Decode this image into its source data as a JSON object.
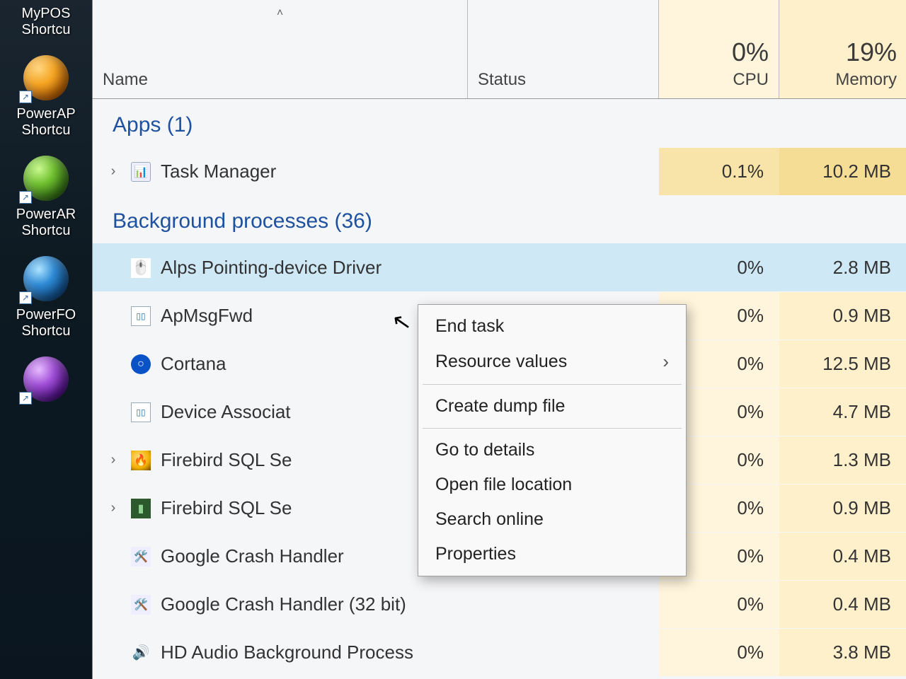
{
  "desktop": {
    "icons": [
      {
        "line1": "MyPOS",
        "line2": "Shortcu"
      },
      {
        "line1": "PowerAP",
        "line2": "Shortcu"
      },
      {
        "line1": "PowerAR",
        "line2": "Shortcu"
      },
      {
        "line1": "PowerFO",
        "line2": "Shortcu"
      }
    ]
  },
  "columns": {
    "name": "Name",
    "status": "Status",
    "cpu": "CPU",
    "memory": "Memory",
    "cpu_pct": "0%",
    "mem_pct": "19%"
  },
  "groups": {
    "apps": {
      "label": "Apps (1)"
    },
    "bg": {
      "label": "Background processes (36)"
    }
  },
  "rows": {
    "task_manager": {
      "name": "Task Manager",
      "cpu": "0.1%",
      "mem": "10.2 MB"
    },
    "alps": {
      "name": "Alps Pointing-device Driver",
      "cpu": "0%",
      "mem": "2.8 MB"
    },
    "apmsg": {
      "name": "ApMsgFwd",
      "cpu": "0%",
      "mem": "0.9 MB"
    },
    "cortana": {
      "name": "Cortana",
      "cpu": "0%",
      "mem": "12.5 MB"
    },
    "devassoc": {
      "name": "Device Associat",
      "cpu": "0%",
      "mem": "4.7 MB"
    },
    "firebird1": {
      "name": "Firebird SQL Se",
      "cpu": "0%",
      "mem": "1.3 MB"
    },
    "firebird2": {
      "name": "Firebird SQL Se",
      "cpu": "0%",
      "mem": "0.9 MB"
    },
    "gch": {
      "name": "Google Crash Handler",
      "cpu": "0%",
      "mem": "0.4 MB"
    },
    "gch32": {
      "name": "Google Crash Handler (32 bit)",
      "cpu": "0%",
      "mem": "0.4 MB"
    },
    "hdaudio": {
      "name": "HD Audio Background Process",
      "cpu": "0%",
      "mem": "3.8 MB"
    }
  },
  "context_menu": {
    "end_task": "End task",
    "resource_values": "Resource values",
    "create_dump": "Create dump file",
    "go_to_details": "Go to details",
    "open_file_loc": "Open file location",
    "search_online": "Search online",
    "properties": "Properties"
  }
}
